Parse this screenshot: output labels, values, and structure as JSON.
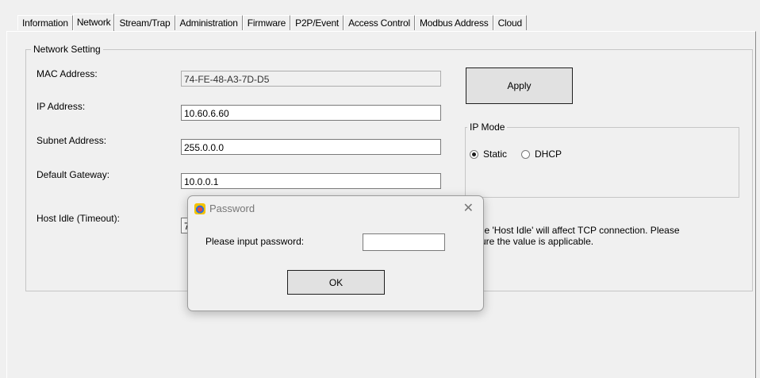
{
  "tabs": [
    "Information",
    "Network",
    "Stream/Trap",
    "Administration",
    "Firmware",
    "P2P/Event",
    "Access Control",
    "Modbus Address",
    "Cloud"
  ],
  "active_tab": "Network",
  "network": {
    "group_title": "Network Setting",
    "mac_label": "MAC Address:",
    "mac_value": "74-FE-48-A3-7D-D5",
    "ip_label": "IP Address:",
    "ip_value": "10.60.6.60",
    "subnet_label": "Subnet Address:",
    "subnet_value": "255.0.0.0",
    "gateway_label": "Default Gateway:",
    "gateway_value": "10.0.0.1",
    "idle_label": "Host Idle (Timeout):",
    "idle_value_visible": "7",
    "apply_label": "Apply",
    "ip_mode_title": "IP Mode",
    "mode_static": "Static",
    "mode_dhcp": "DHCP",
    "selected_mode": "Static",
    "note_line1": ":  The 'Host Idle' will affect TCP connection.  Please",
    "note_line2": "e sure the value is applicable."
  },
  "dialog": {
    "title": "Password",
    "prompt": "Please input password:",
    "password_value": "",
    "ok_label": "OK",
    "close_glyph": "✕"
  }
}
